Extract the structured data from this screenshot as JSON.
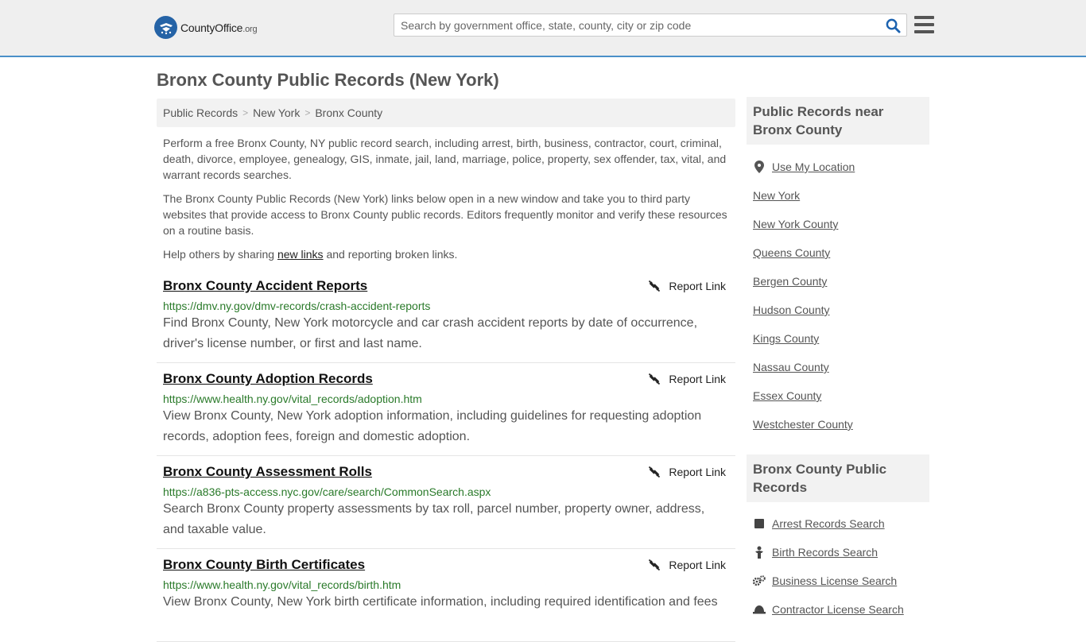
{
  "header": {
    "logo_brand": "CountyOffice",
    "logo_tld": ".org",
    "search_placeholder": "Search by government office, state, county, city or zip code"
  },
  "page_title": "Bronx County Public Records (New York)",
  "breadcrumb": [
    "Public Records",
    "New York",
    "Bronx County"
  ],
  "intro": {
    "p1": "Perform a free Bronx County, NY public record search, including arrest, birth, business, contractor, court, criminal, death, divorce, employee, genealogy, GIS, inmate, jail, land, marriage, police, property, sex offender, tax, vital, and warrant records searches.",
    "p2": "The Bronx County Public Records (New York) links below open in a new window and take you to third party websites that provide access to Bronx County public records. Editors frequently monitor and verify these resources on a routine basis.",
    "p3_before": "Help others by sharing ",
    "p3_link": "new links",
    "p3_after": " and reporting broken links."
  },
  "report_label": "Report Link",
  "records": [
    {
      "title": "Bronx County Accident Reports",
      "url": "https://dmv.ny.gov/dmv-records/crash-accident-reports",
      "desc": "Find Bronx County, New York motorcycle and car crash accident reports by date of occurrence, driver's license number, or first and last name."
    },
    {
      "title": "Bronx County Adoption Records",
      "url": "https://www.health.ny.gov/vital_records/adoption.htm",
      "desc": "View Bronx County, New York adoption information, including guidelines for requesting adoption records, adoption fees, foreign and domestic adoption."
    },
    {
      "title": "Bronx County Assessment Rolls",
      "url": "https://a836-pts-access.nyc.gov/care/search/CommonSearch.aspx",
      "desc": "Search Bronx County property assessments by tax roll, parcel number, property owner, address, and taxable value."
    },
    {
      "title": "Bronx County Birth Certificates",
      "url": "https://www.health.ny.gov/vital_records/birth.htm",
      "desc": "View Bronx County, New York birth certificate information, including required identification and fees"
    }
  ],
  "sidebar": {
    "near_heading": "Public Records near Bronx County",
    "near_items": [
      "Use My Location",
      "New York",
      "New York County",
      "Queens County",
      "Bergen County",
      "Hudson County",
      "Kings County",
      "Nassau County",
      "Essex County",
      "Westchester County"
    ],
    "records_heading": "Bronx County Public Records",
    "records_items": [
      "Arrest Records Search",
      "Birth Records Search",
      "Business License Search",
      "Contractor License Search"
    ]
  }
}
